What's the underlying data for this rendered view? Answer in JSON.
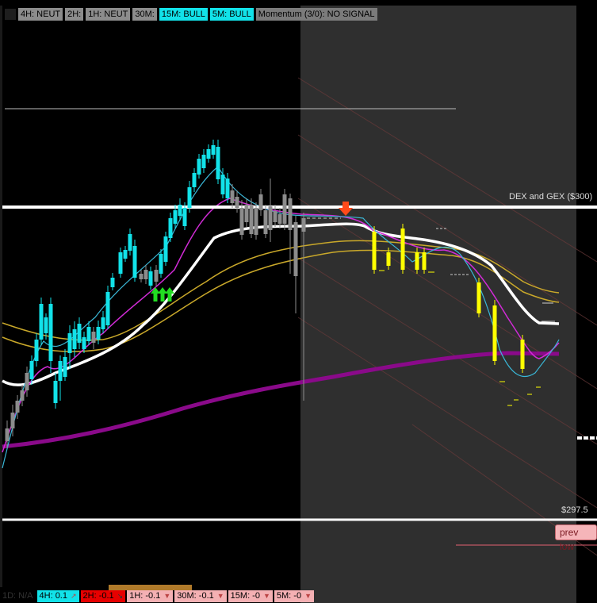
{
  "top_bar": {
    "tags": [
      {
        "label": "4H: NEUT",
        "state": "neutral"
      },
      {
        "label": "2H:",
        "state": "neutral"
      },
      {
        "label": "1H: NEUT",
        "state": "neutral"
      },
      {
        "label": "30M:",
        "state": "neutral"
      },
      {
        "label": "15M: BULL",
        "state": "bull"
      },
      {
        "label": "5M: BULL",
        "state": "bull"
      },
      {
        "label": "Momentum (3/0): NO SIGNAL",
        "state": "momentum"
      }
    ]
  },
  "levels": {
    "dex_gex_label": "DEX and GEX ($300)",
    "price_label": "$297.5",
    "prev_low_label": "prev low"
  },
  "bottom_bar": {
    "items": [
      {
        "label": "1D: N/A",
        "style": "first"
      },
      {
        "label": "4H: 0.1",
        "style": "cyan"
      },
      {
        "label": "2H: -0.1",
        "style": "red"
      },
      {
        "label": "1H: -0.1",
        "style": "pink"
      },
      {
        "label": "30M: -0.1",
        "style": "pink"
      },
      {
        "label": "15M: -0",
        "style": "pink"
      },
      {
        "label": "5M: -0",
        "style": "pink"
      }
    ]
  },
  "colors": {
    "background": "#000000",
    "after_hours_shade": "#2f2f2f",
    "bull_candle": "#12e2e9",
    "neutral_candle": "#8c8c8c",
    "bear_candle": "#ffff00",
    "ema_white": "#ffffff",
    "ema_cyan": "#3ab8d8",
    "ema_magenta": "#d12bd6",
    "ema_gold": "#c9a82a",
    "sma_purple": "#8a0a8a",
    "buy_arrow": "#22dd22",
    "sell_arrow": "#ff4a1a"
  }
}
